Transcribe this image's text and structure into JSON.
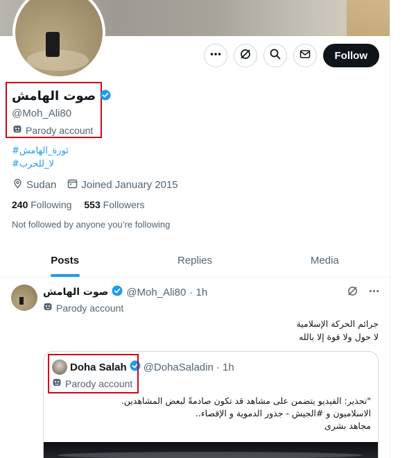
{
  "profile": {
    "display_name": "صوت الهامش",
    "handle": "@Moh_Ali80",
    "parody_label": "Parody account",
    "hashtags": [
      "#ثورة_الهامش",
      "#لا_للحرب"
    ],
    "location": "Sudan",
    "joined": "Joined January 2015",
    "following_count": "240",
    "following_label": "Following",
    "followers_count": "553",
    "followers_label": "Followers",
    "not_followed_text": "Not followed by anyone you’re following"
  },
  "actions": {
    "follow_label": "Follow",
    "icons": [
      "more-icon",
      "grok-icon",
      "search-icon",
      "message-icon"
    ]
  },
  "tabs": [
    {
      "label": "Posts",
      "active": true
    },
    {
      "label": "Replies",
      "active": false
    },
    {
      "label": "Media",
      "active": false
    }
  ],
  "tweet": {
    "author_name": "صوت الهامش",
    "author_handle": "@Moh_Ali80",
    "time": "· 1h",
    "parody_label": "Parody account",
    "text_lines": [
      "جرائم الحركة الإسلامية",
      "لا حول ولا قوة إلا بالله"
    ],
    "quote": {
      "author_name": "Doha Salah",
      "author_handle": "@DohaSaladin",
      "time": "· 1h",
      "parody_label": "Parody account",
      "text_lines": [
        "\"تحذير: الفيديو يتضمن على مشاهد قد تكون صادمةً لبعض المشاهدين.",
        "الاسلاميون و #الجيش - جذور الدموية و الإقصاء..",
        "مجاهد بشرى"
      ]
    }
  },
  "colors": {
    "accent": "#1d9bf0",
    "text": "#0f1419",
    "muted": "#536471",
    "highlight_box": "#d0021b"
  }
}
